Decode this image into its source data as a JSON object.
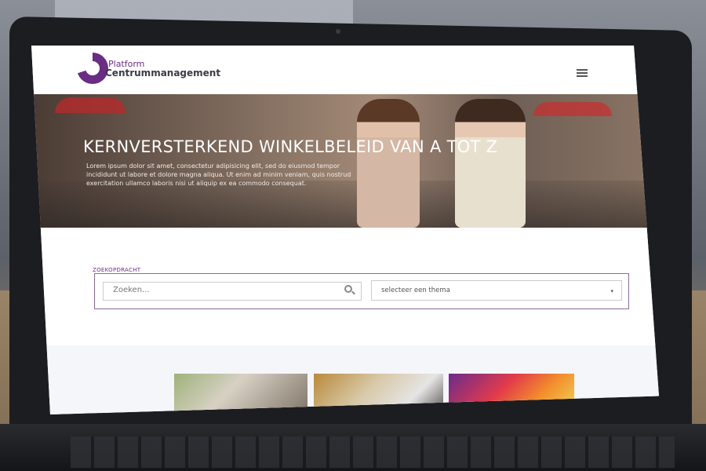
{
  "header": {
    "logo_small": "Platform",
    "logo_big": "Centrummanagement"
  },
  "hero": {
    "title": "KERNVERSTERKEND WINKELBELEID VAN A TOT Z",
    "text": "Lorem ipsum dolor sit amet, consectetur adipisicing elit, sed do eiusmod tempor incididunt ut labore et dolore magna aliqua. Ut enim ad minim veniam, quis nostrud exercitation ullamco laboris nisi ut aliquip ex ea commodo consequat."
  },
  "search": {
    "label": "ZOEKOPDRACHT",
    "placeholder": "Zoeken...",
    "theme_select": "selecteer een thema"
  },
  "colors": {
    "brand": "#6a2d83"
  }
}
